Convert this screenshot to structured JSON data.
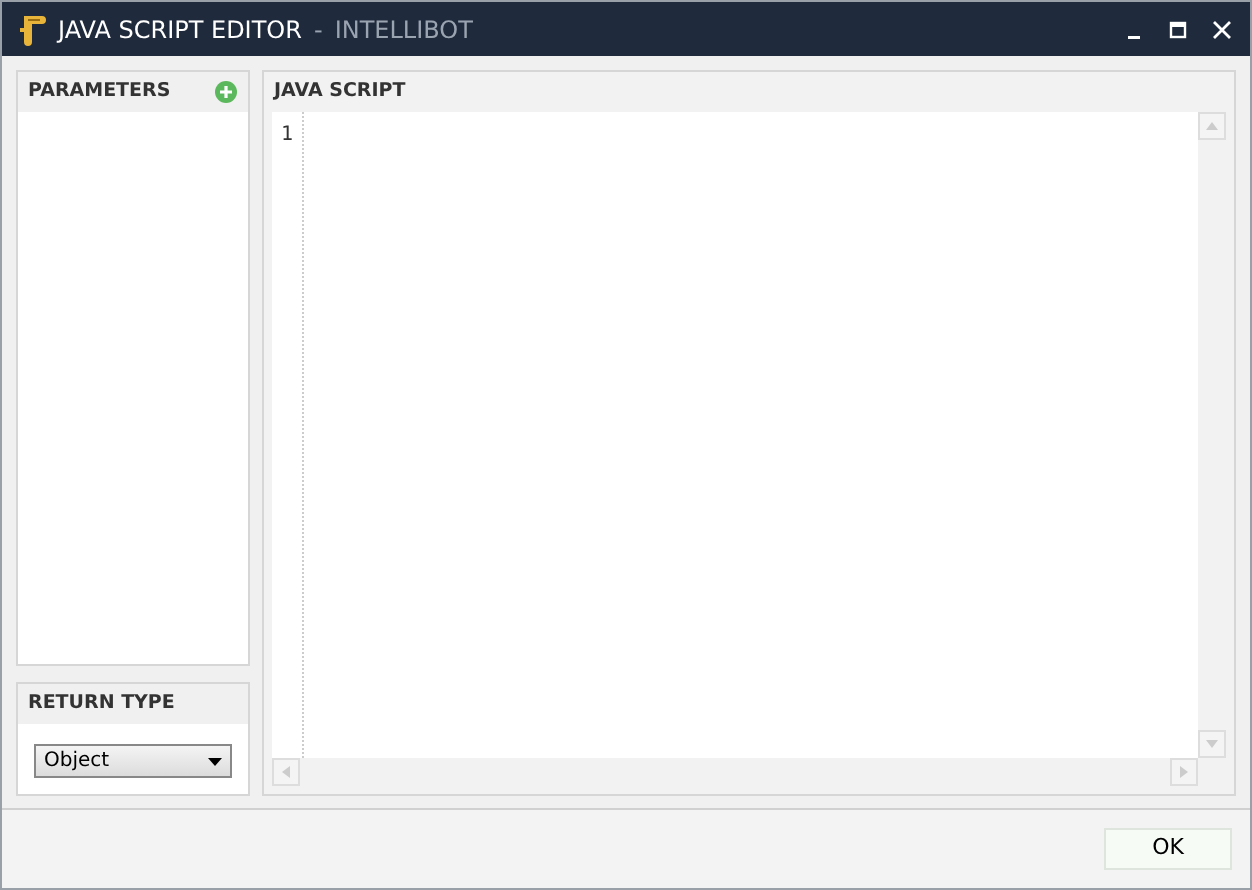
{
  "window": {
    "title": "JAVA SCRIPT EDITOR",
    "separator": "-",
    "app": "INTELLIBOT"
  },
  "parameters": {
    "title": "PARAMETERS"
  },
  "return_type": {
    "title": "RETURN TYPE",
    "value": "Object"
  },
  "editor": {
    "title": "JAVA SCRIPT",
    "line_numbers": [
      "1"
    ]
  },
  "buttons": [
    "OK"
  ]
}
